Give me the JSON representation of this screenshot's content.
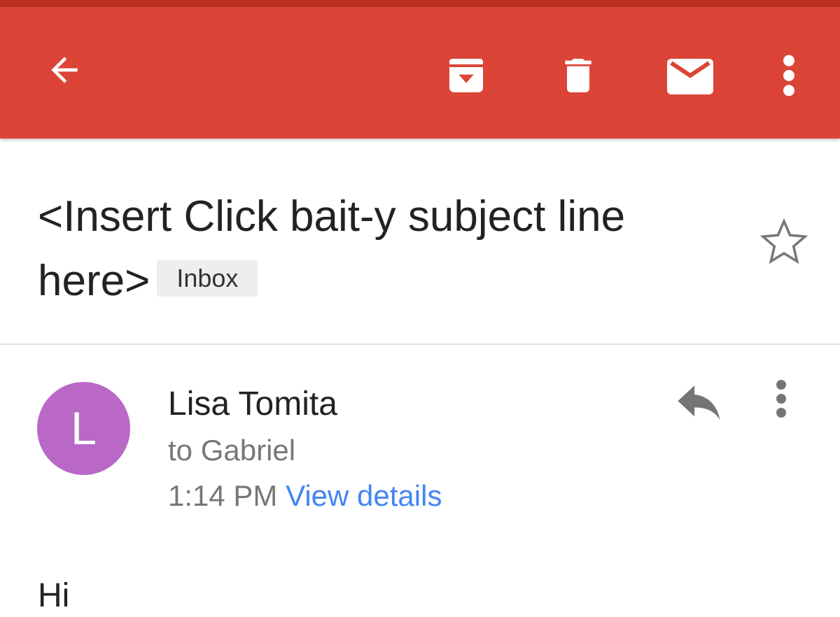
{
  "toolbar": {
    "background_color": "#db4437",
    "icons": {
      "back": "arrow-back-icon",
      "archive": "archive-icon",
      "delete": "trash-icon",
      "mark_unread": "mail-icon",
      "more": "more-vert-icon"
    }
  },
  "subject": {
    "text": "<Insert Click bait-y subject line here>",
    "label": "Inbox",
    "starred": false
  },
  "message": {
    "avatar_initial": "L",
    "avatar_color": "#ba68c8",
    "sender": "Lisa Tomita",
    "recipient": "to Gabriel",
    "time": "1:14 PM",
    "view_details": "View details",
    "link_color": "#4285f4",
    "body_preview": "Hi"
  }
}
